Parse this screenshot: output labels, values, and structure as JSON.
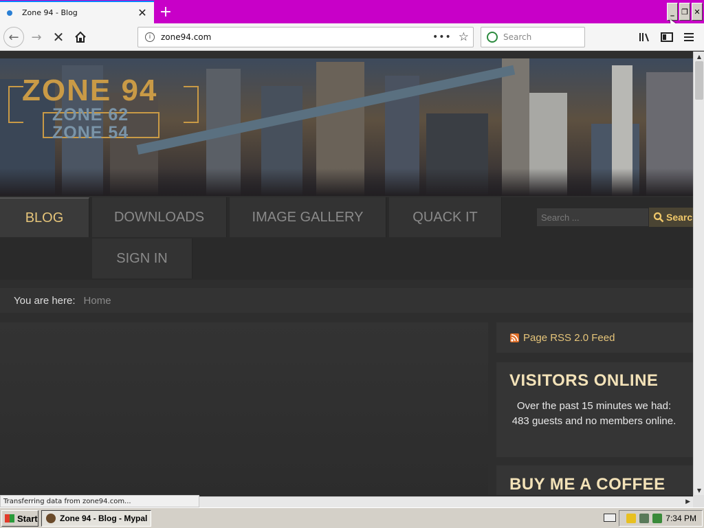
{
  "browser": {
    "tab_title": "Zone 94 - Blog",
    "url": "zone94.com",
    "search_placeholder": "Search",
    "status_text": "Transferring data from zone94.com..."
  },
  "site": {
    "logo": {
      "line1": "ZONE 94",
      "line2": "ZONE 62",
      "line3": "ZONE 54"
    },
    "menu": [
      {
        "label": "BLOG",
        "active": true
      },
      {
        "label": "DOWNLOADS",
        "active": false
      },
      {
        "label": "IMAGE GALLERY",
        "active": false
      },
      {
        "label": "QUACK IT",
        "active": false
      },
      {
        "label": "SIGN IN",
        "active": false
      }
    ],
    "site_search": {
      "placeholder": "Search ...",
      "button_label": "Search"
    },
    "breadcrumb": {
      "label": "You are here:",
      "current": "Home"
    },
    "sidebar": {
      "rss_label": "Page RSS 2.0 Feed",
      "visitors_title": "VISITORS ONLINE",
      "visitors_text": "Over the past 15 minutes we had: 483 guests and no members online.",
      "coffee_title": "BUY ME A COFFEE"
    }
  },
  "taskbar": {
    "start_label": "Start",
    "task_label": "Zone 94 - Blog - Mypal",
    "clock": "7:34 PM"
  },
  "colors": {
    "tabbar": "#c800c8",
    "accent_gold": "#e6c57a",
    "menu_text": "#8a8a8a",
    "sidebar_heading": "#f3e2b8"
  }
}
